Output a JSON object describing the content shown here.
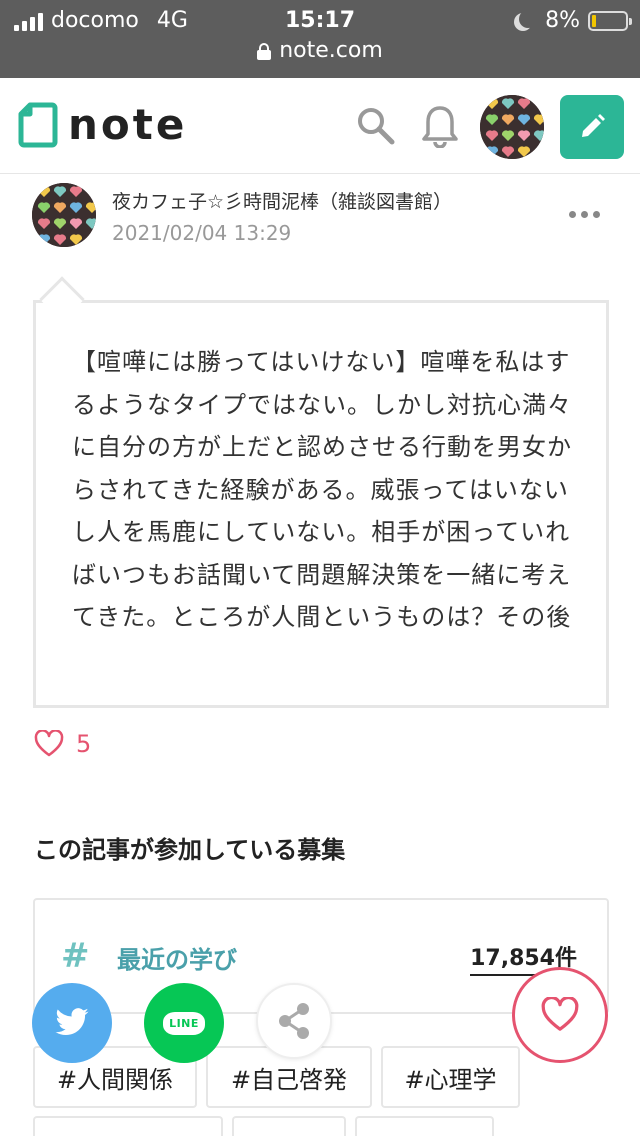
{
  "status_bar": {
    "carrier": "docomo",
    "network": "4G",
    "time": "15:17",
    "battery": "8%",
    "url": "note.com"
  },
  "header": {
    "logo_text": "note",
    "brand_color": "#2cb696"
  },
  "post": {
    "author_name": "夜カフェ子☆彡時間泥棒（雑談図書館）",
    "date": "2021/02/04 13:29",
    "body": "【喧嘩には勝ってはいけない】喧嘩を私はするようなタイプではない。しかし対抗心満々に自分の方が上だと認めさせる行動を男女からされてきた経験がある。威張ってはいないし人を馬鹿にしていない。相手が困っていればいつもお話聞いて問題解決策を一緒に考えてきた。ところが人間というものは？その後",
    "like_count": "5"
  },
  "contest": {
    "section_title": "この記事が参加している募集",
    "hash": "#",
    "title": "最近の学び",
    "count": "17,854件"
  },
  "tags": [
    "#人間関係",
    "#自己啓発",
    "#心理学"
  ],
  "share": {
    "line_label": "LINE"
  },
  "colors": {
    "accent": "#2cb696",
    "like": "#e5536f",
    "twitter": "#55acee",
    "line": "#06c755",
    "contest_title": "#4aa0aa"
  }
}
